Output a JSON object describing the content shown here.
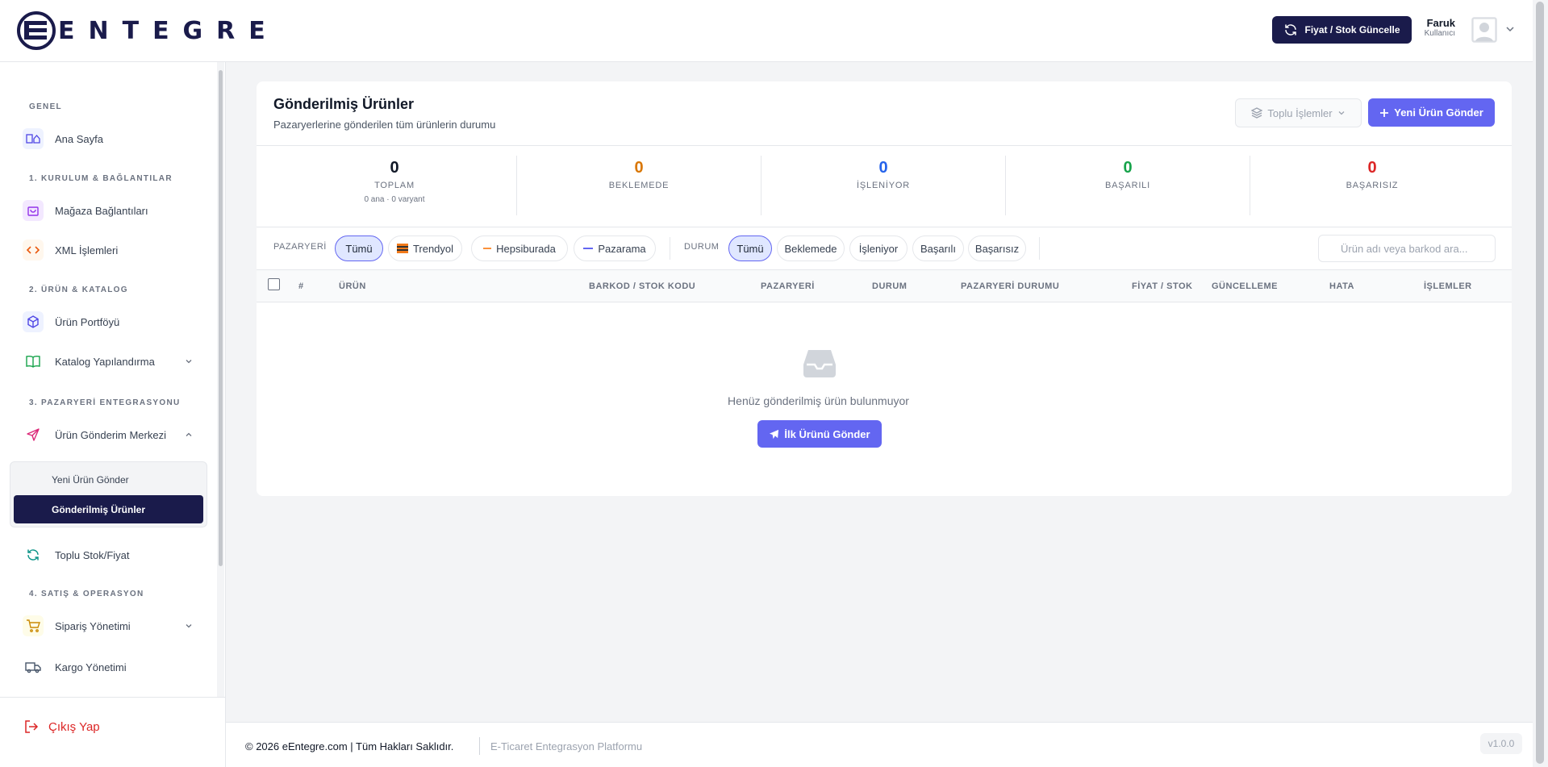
{
  "header": {
    "logo_text": "ENTEGRE",
    "sync_button": "Fiyat / Stok Güncelle",
    "user_name": "Faruk",
    "user_role": "Kullanıcı"
  },
  "sidebar": {
    "sections": {
      "genel": "GENEL",
      "kurulum": "1. KURULUM & BAĞLANTILAR",
      "urun": "2. ÜRÜN & KATALOG",
      "pazaryeri": "3. PAZARYERİ ENTEGRASYONU",
      "satis": "4. SATIŞ & OPERASYON"
    },
    "items": {
      "home": "Ana Sayfa",
      "store": "Mağaza Bağlantıları",
      "xml": "XML İşlemleri",
      "portfolio": "Ürün Portföyü",
      "catalog": "Katalog Yapılandırma",
      "send_center": "Ürün Gönderim Merkezi",
      "new_send": "Yeni Ürün Gönder",
      "sent": "Gönderilmiş Ürünler",
      "bulk": "Toplu Stok/Fiyat",
      "orders": "Sipariş Yönetimi",
      "cargo": "Kargo Yönetimi"
    },
    "logout": "Çıkış Yap"
  },
  "main": {
    "title": "Gönderilmiş Ürünler",
    "subtitle": "Pazaryerlerine gönderilen tüm ürünlerin durumu",
    "bulk_button": "Toplu İşlemler",
    "new_button": "Yeni Ürün Gönder",
    "stats": {
      "total": {
        "value": "0",
        "label": "TOPLAM",
        "sub": "0 ana · 0 varyant"
      },
      "pending": {
        "value": "0",
        "label": "BEKLEMEDE"
      },
      "processing": {
        "value": "0",
        "label": "İŞLENİYOR"
      },
      "success": {
        "value": "0",
        "label": "BAŞARILI"
      },
      "failed": {
        "value": "0",
        "label": "BAŞARISIZ"
      }
    },
    "filters": {
      "marketplace_label": "PAZARYERİ",
      "marketplace": {
        "all": "Tümü",
        "trendyol": "Trendyol",
        "hepsiburada": "Hepsiburada",
        "pazarama": "Pazarama"
      },
      "status_label": "DURUM",
      "status": {
        "all": "Tümü",
        "pending": "Beklemede",
        "processing": "İşleniyor",
        "success": "Başarılı",
        "failed": "Başarısız"
      },
      "search_placeholder": "Ürün adı veya barkod ara..."
    },
    "table_headers": {
      "num": "#",
      "product": "ÜRÜN",
      "barcode": "BARKOD / STOK KODU",
      "marketplace": "PAZARYERİ",
      "status": "DURUM",
      "mp_status": "PAZARYERİ DURUMU",
      "price": "FİYAT / STOK",
      "updated": "GÜNCELLEME",
      "error": "HATA",
      "actions": "İŞLEMLER"
    },
    "empty_text": "Henüz gönderilmiş ürün bulunmuyor",
    "first_button": "İlk Ürünü Gönder"
  },
  "footer": {
    "copyright": "© 2026 eEntegre.com | Tüm Hakları Saklıdır.",
    "platform": "E-Ticaret Entegrasyon Platformu",
    "version": "v1.0.0"
  },
  "colors": {
    "brand": "#1a1b4b",
    "accent": "#6366f1",
    "pending": "#d97706",
    "processing": "#2563eb",
    "success": "#16a34a",
    "failed": "#dc2626"
  }
}
